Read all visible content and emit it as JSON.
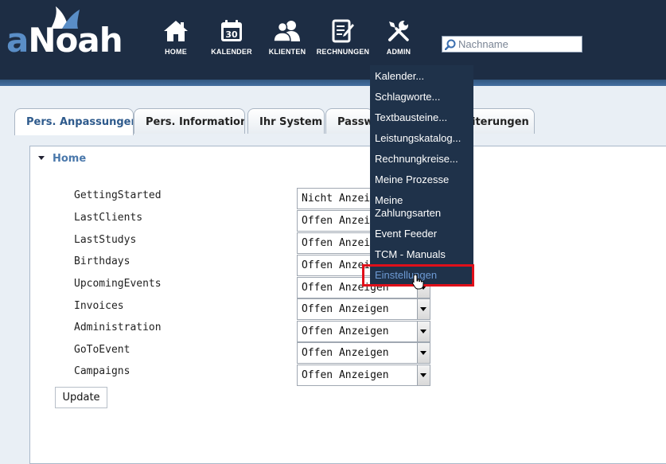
{
  "brand": {
    "logo_a": "a",
    "logo_rest": "Noah"
  },
  "nav": [
    {
      "label": "HOME",
      "icon": "home-icon"
    },
    {
      "label": "KALENDER",
      "icon": "calendar-icon",
      "badge": "30"
    },
    {
      "label": "KLIENTEN",
      "icon": "users-icon"
    },
    {
      "label": "RECHNUNGEN",
      "icon": "invoice-icon"
    },
    {
      "label": "ADMIN",
      "icon": "tools-icon"
    }
  ],
  "search": {
    "placeholder": "Nachname",
    "value": ""
  },
  "tabs": [
    {
      "label": "Pers. Anpassungen",
      "active": true
    },
    {
      "label": "Pers. Information"
    },
    {
      "label": "Ihr System"
    },
    {
      "label": "Passwo"
    },
    {
      "label": "iterungen"
    }
  ],
  "panel": {
    "title": "Home",
    "rows": [
      {
        "label": "GettingStarted",
        "value": "Nicht Anzeigen"
      },
      {
        "label": "LastClients",
        "value": "Offen Anzeigen"
      },
      {
        "label": "LastStudys",
        "value": "Offen Anzeigen"
      },
      {
        "label": "Birthdays",
        "value": "Offen Anzeigen"
      },
      {
        "label": "UpcomingEvents",
        "value": "Offen Anzeigen"
      },
      {
        "label": "Invoices",
        "value": "Offen Anzeigen"
      },
      {
        "label": "Administration",
        "value": "Offen Anzeigen"
      },
      {
        "label": "GoToEvent",
        "value": "Offen Anzeigen"
      },
      {
        "label": "Campaigns",
        "value": "Offen Anzeigen"
      }
    ],
    "update_label": "Update"
  },
  "admin_menu": [
    "Kalender...",
    "Schlagworte...",
    "Textbausteine...",
    "Leistungskatalog...",
    "Rechnungkreise...",
    "Meine Prozesse",
    "Meine\nZahlungsarten",
    "Event Feeder",
    "TCM - Manuals",
    "Einstellungen"
  ],
  "colors": {
    "header": "#1d2d44",
    "accent": "#4a78ab",
    "menu_bg": "#1f324a",
    "highlight": "#e0101a",
    "menu_hover": "#6d9ad4"
  }
}
